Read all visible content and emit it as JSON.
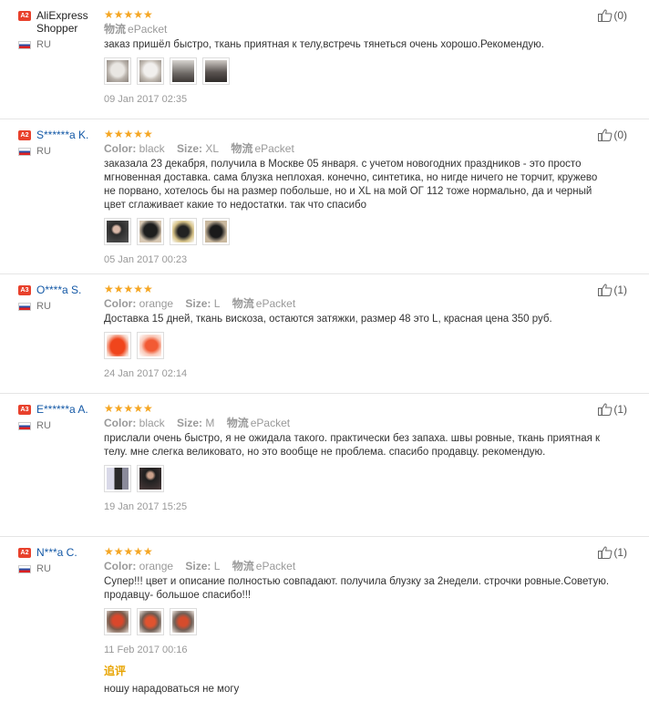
{
  "labels": {
    "color": "Color:",
    "size": "Size:",
    "shipping": "物流",
    "append": "追评"
  },
  "reviews": [
    {
      "badge": "A2",
      "name": "AliExpress Shopper",
      "country": "RU",
      "rating": 5,
      "stars": "★★★★★",
      "color": "",
      "size": "",
      "shipping": "ePacket",
      "text": "заказ пришёл быстро, ткань приятная к телу,встречь тянеться очень хорошо.Рекомендую.",
      "photos": [
        "light",
        "light",
        "dark",
        "dark"
      ],
      "date": "09 Jan 2017 02:35",
      "helpful": "(0)"
    },
    {
      "badge": "A2",
      "name": "S******a K.",
      "country": "RU",
      "rating": 5,
      "stars": "★★★★★",
      "color": "black",
      "size": "XL",
      "shipping": "ePacket",
      "text": "заказала 23 декабря, получила в Москве 05 января. с учетом новогодних праздников - это просто мгновенная доставка. сама блузка неплохая. конечно, синтетика, но нигде ничего не торчит, кружево не порвано, хотелось бы на размер побольше, но и XL на мой ОГ 112 тоже нормально, да и черный цвет сглаживает какие то недостатки. так что спасибо",
      "photos": [
        "dark",
        "dark",
        "dark",
        "dark"
      ],
      "date": "05 Jan 2017 00:23",
      "helpful": "(0)"
    },
    {
      "badge": "A3",
      "name": "O****a S.",
      "country": "RU",
      "rating": 5,
      "stars": "★★★★★",
      "color": "orange",
      "size": "L",
      "shipping": "ePacket",
      "text": "Доставка 15 дней, ткань вискоза, остаются затяжки, размер 48 это L, красная цена 350 руб.",
      "photos": [
        "orange",
        "orange"
      ],
      "date": "24 Jan 2017 02:14",
      "helpful": "(1)"
    },
    {
      "badge": "A3",
      "name": "E******a A.",
      "country": "RU",
      "rating": 5,
      "stars": "★★★★★",
      "color": "black",
      "size": "M",
      "shipping": "ePacket",
      "text": "прислали очень быстро, я не ожидала такого. практически без запаха. швы ровные, ткань приятная к телу. мне слегка великовато, но это вообще не проблема. спасибо продавцу. рекомендую.",
      "photos": [
        "mixed",
        "dark"
      ],
      "date": "19 Jan 2017 15:25",
      "helpful": "(1)"
    },
    {
      "badge": "A2",
      "name": "N***a C.",
      "country": "RU",
      "rating": 5,
      "stars": "★★★★★",
      "color": "orange",
      "size": "L",
      "shipping": "ePacket",
      "text": "Супер!!! цвет и описание полностью совпадают. получила блузку за 2недели. строчки ровные.Советую. продавцу- большое спасибо!!!",
      "photos": [
        "orange",
        "orange",
        "orange"
      ],
      "date": "11 Feb 2017 00:16",
      "helpful": "(1)",
      "append": "ношу нарадоваться не могу"
    }
  ],
  "colors": {
    "star": "#f5a623",
    "badge": "#e8412c",
    "link": "#1358a6",
    "append_label": "#e8a400"
  }
}
